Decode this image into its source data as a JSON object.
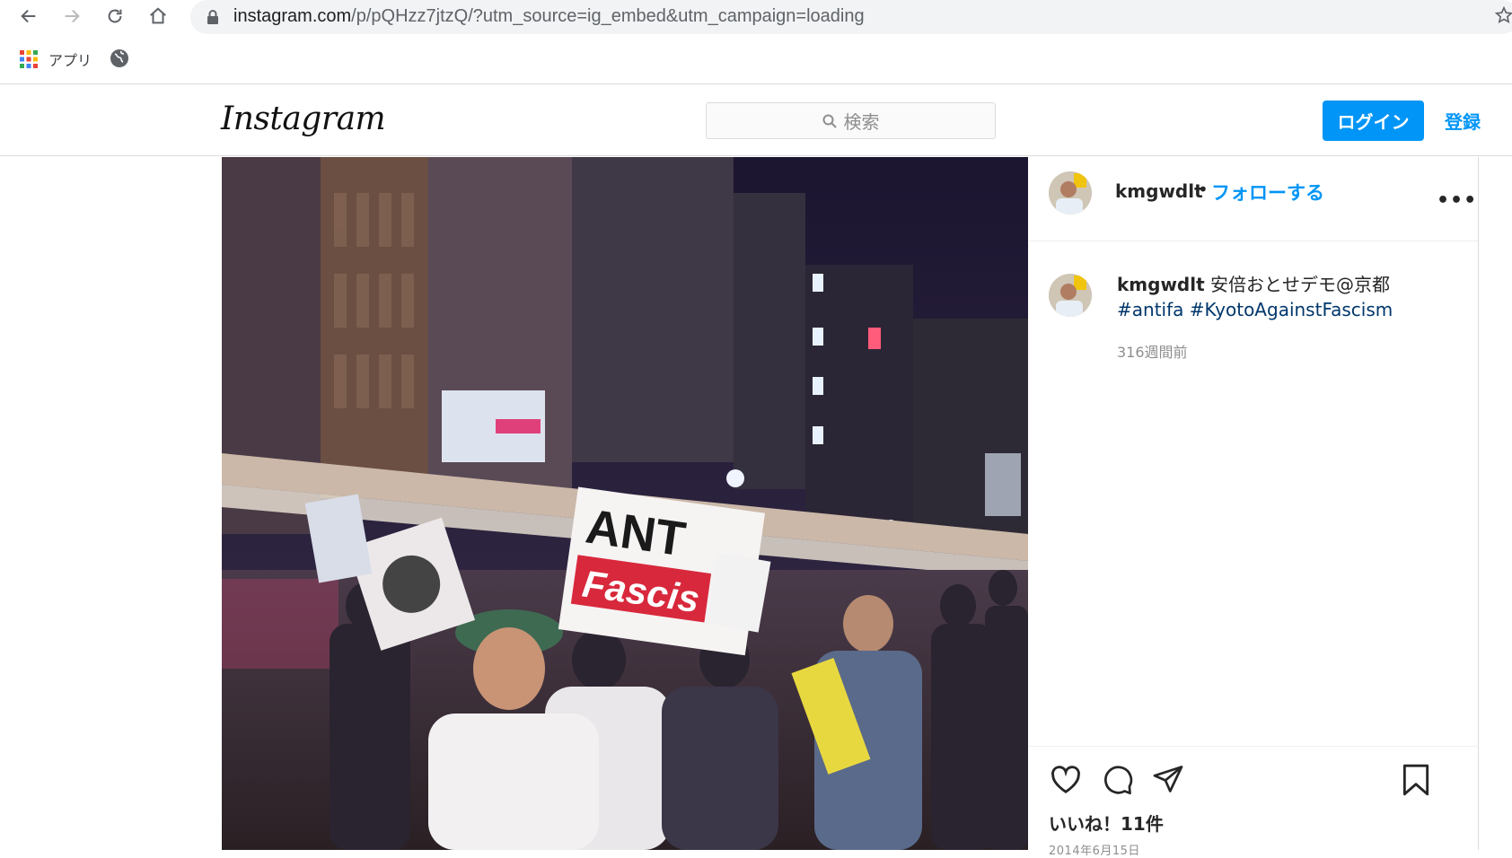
{
  "browser": {
    "url_host": "instagram.com",
    "url_rest": "/p/pQHzz7jtzQ/?utm_source=ig_embed&utm_campaign=loading",
    "bookmarks": {
      "apps_label": "アプリ"
    }
  },
  "header": {
    "logo": "Instagram",
    "search_placeholder": "検索",
    "login_label": "ログイン",
    "signup_label": "登録"
  },
  "post": {
    "image_sign_text": "ANTI Fascism",
    "username": "kmgwdlt",
    "dot": "•",
    "follow_label": "フォローする",
    "more": "•••",
    "caption_text": "安倍おとせデモ@京都",
    "caption_tags": "#antifa #KyotoAgainstFascism",
    "time_ago": "316週間前",
    "likes": "いいね！11件",
    "date": "2014年6月15日"
  },
  "colors": {
    "accent": "#0095f6",
    "hashtag": "#00376b",
    "secondary_text": "#8e8e8e",
    "border": "#dbdbdb"
  }
}
